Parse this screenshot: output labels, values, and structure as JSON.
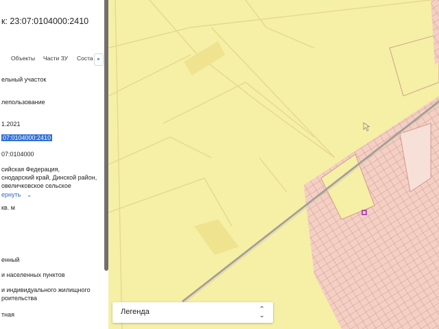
{
  "header": {
    "title": "к: 23:07:0104000:2410"
  },
  "tabs": [
    "Объекты",
    "Части ЗУ",
    "Соста"
  ],
  "tab_next_icon": "chevron-right-icon",
  "fields": {
    "type": "ельный участок",
    "ownership": "лепользование",
    "date": "1.2021",
    "cadastral_number": "07:0104000:2410",
    "quarter": "07:0104000",
    "address_line1": "сийская Федерация,",
    "address_line2": "снодарский край, Динской район,",
    "address_line3": "овеличковское сельское",
    "collapse_link": "ернуть",
    "area": "кв. м",
    "status": "енный",
    "category": "и населенных пунктов",
    "usage_line1": "и индивидуального жилищного",
    "usage_line2": "роительства",
    "form": "тная"
  },
  "legend": {
    "label": "Легенда",
    "icon": "chevron-up-down-icon"
  },
  "colors": {
    "map_background": "#f6efa6",
    "parcel_lines": "#e3d98a",
    "settlement_fill": "#f4cfc4",
    "settlement_lines": "#c98b84",
    "road": "#a59f98",
    "selection_blue": "#2f6fd6",
    "link_blue": "#2a66c9",
    "marker": "#9b2ab3"
  }
}
